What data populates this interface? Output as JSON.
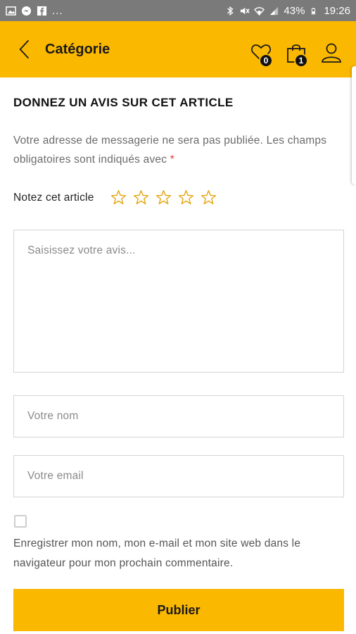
{
  "status_bar": {
    "left_icons": [
      "image-icon",
      "messenger-icon",
      "facebook-icon"
    ],
    "dots": "...",
    "battery": "43%",
    "time": "19:26"
  },
  "header": {
    "title": "Catégorie",
    "wishlist_count": "0",
    "cart_count": "1",
    "background": "#fbb800"
  },
  "review": {
    "title": "DONNEZ UN AVIS SUR CET ARTICLE",
    "notice": "Votre adresse de messagerie ne sera pas publiée. Les champs obligatoires sont indiqués avec",
    "required_mark": "*",
    "rating_label": "Notez cet article",
    "rating_value": 0,
    "rating_max": 5,
    "review_placeholder": "Saisissez votre avis...",
    "name_placeholder": "Votre nom",
    "email_placeholder": "Votre email",
    "save_info_checked": false,
    "consent_text": "Enregistrer mon nom, mon e-mail et mon site web dans le navigateur pour mon prochain commentaire.",
    "submit_label": "Publier"
  },
  "colors": {
    "accent": "#fbb800",
    "star": "#e6a817",
    "required": "#e03b3b"
  }
}
